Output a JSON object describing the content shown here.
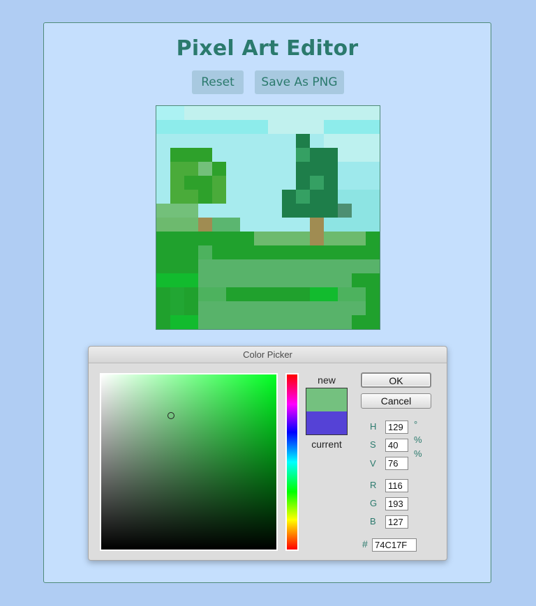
{
  "app": {
    "title": "Pixel Art Editor",
    "reset_label": "Reset",
    "save_label": "Save As PNG"
  },
  "canvas": {
    "grid_size": 16,
    "palette": {
      "a": "#acf2f3",
      "b": "#c1f1ee",
      "c": "#8deceb",
      "s": "#a7ebee",
      "d": "#bdf1ef",
      "e": "#9ee9ec",
      "f": "#8de4e3",
      "G": "#2ea12b",
      "H": "#4aab3a",
      "I": "#73c07a",
      "J": "#1e7e4a",
      "K": "#35a063",
      "L": "#4d8f72",
      "T": "#a08c52",
      "M": "#5bb670",
      "N": "#6dba6e",
      "O": "#20a12d",
      "P": "#4db25e",
      "Q": "#12bb2e",
      "R": "#22a633",
      "U": "#58b36a"
    },
    "pixels": [
      "aabbbbbbbbbbbbbb",
      "ccccccccbbbbcccc",
      "ssssssssssJsdddd",
      "sGGGssssssKJJddd",
      "sHHIGsssssJJJeee",
      "sHGGHsssssJKJeee",
      "sHHGHssssJKJJfff",
      "IIIssssssJJJJLff",
      "NNNTMMsssssTffff",
      "OOOOOOONNNNTNNNO",
      "OOOPOOOOOOOOOOOO",
      "OOOUUUUUUUUUUUUU",
      "QQQUUUUUUUUUUUOO",
      "OROPPOOOOOOQQPPO",
      "OROUUUUUUUUUUUUO",
      "OQQUUUUUUUUUUUOO"
    ]
  },
  "color_picker": {
    "title": "Color Picker",
    "new_label": "new",
    "current_label": "current",
    "new_color": "#74c17f",
    "current_color": "#5542d6",
    "ok_label": "OK",
    "cancel_label": "Cancel",
    "h_label": "H",
    "h_value": "129",
    "h_unit": "°",
    "s_label": "S",
    "s_value": "40",
    "s_unit": "%",
    "v_label": "V",
    "v_value": "76",
    "v_unit": "%",
    "r_label": "R",
    "r_value": "116",
    "g_label": "G",
    "g_value": "193",
    "b_label": "B",
    "b_value": "127",
    "hex_label": "#",
    "hex_value": "74C17F"
  }
}
